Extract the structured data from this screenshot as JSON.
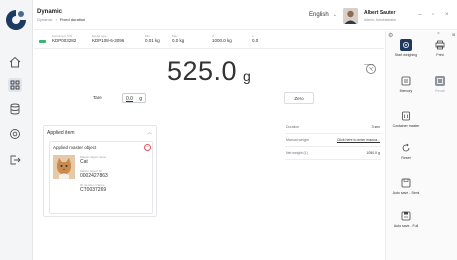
{
  "app": {
    "title": "Dynamic",
    "breadcrumb": [
      "Dynamic",
      "Fixed duration"
    ]
  },
  "header": {
    "language": "English",
    "user": {
      "name": "Albert Sauter",
      "role": "Admin, Administrator"
    }
  },
  "device": {
    "status_color": "#3cb371",
    "fields": [
      {
        "caption": "Instrument S/N",
        "value": "KDP003282"
      },
      {
        "caption": "Model type",
        "value": "KDP108-6-3096"
      },
      {
        "caption": "Min",
        "value": "0.01 kg"
      },
      {
        "caption": "Max",
        "value": "0.0 kg"
      },
      {
        "caption": "d",
        "value": "1000.0 kg"
      },
      {
        "caption": "e",
        "value": "0.0"
      }
    ]
  },
  "scale": {
    "weight": "525.0",
    "unit": "g",
    "tare_button": "Tare",
    "tare_value": "0.0",
    "tare_unit": "g",
    "zero_button": "Zero"
  },
  "applied_item": {
    "title": "Applied item",
    "card_title": "Applied master object",
    "fields": [
      {
        "caption": "Master object name",
        "value": "Cat"
      },
      {
        "caption": "Master object ID",
        "value": "0002427863"
      },
      {
        "caption": "ID number / Name",
        "value": "CT0037269"
      }
    ]
  },
  "info": [
    {
      "label": "Duration",
      "value": "3 sec",
      "link": false
    },
    {
      "label": "Manual weight",
      "value": "Click here to enter manua...",
      "link": true
    },
    {
      "label": "Net weight (1)",
      "value": "1050.0 g",
      "link": false
    }
  ],
  "actions": [
    {
      "label": "Start weighing",
      "icon": "weighing-icon",
      "enabled": true,
      "primary": true
    },
    {
      "label": "Print",
      "icon": "print-icon",
      "enabled": true,
      "primary": false
    },
    {
      "label": "Memory",
      "icon": "memory-icon",
      "enabled": true,
      "primary": false
    },
    {
      "label": "Recall",
      "icon": "recall-icon",
      "enabled": false,
      "primary": false
    },
    {
      "label": "Container master",
      "icon": "container-icon",
      "enabled": true,
      "primary": false
    },
    {
      "label": "Reset",
      "icon": "reset-icon",
      "enabled": true,
      "primary": false
    },
    {
      "label": "Auto save - Semi",
      "icon": "auto-save-semi-icon",
      "enabled": true,
      "primary": false
    },
    {
      "label": "Auto save - Full",
      "icon": "auto-save-full-icon",
      "enabled": true,
      "primary": false
    }
  ],
  "colors": {
    "accent": "#1f3a5f",
    "danger": "#e05560",
    "ok": "#3cb371"
  }
}
